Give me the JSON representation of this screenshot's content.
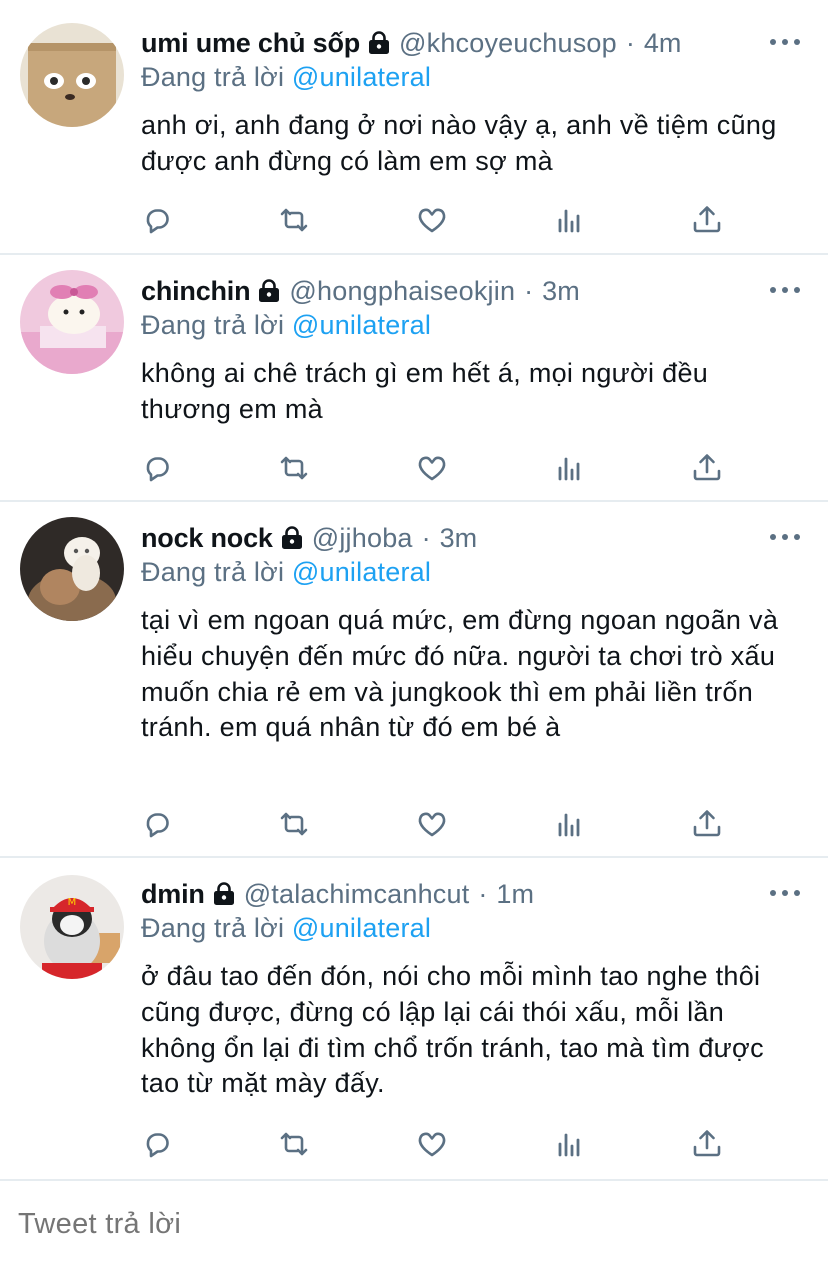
{
  "tweets": [
    {
      "name": "umi ume chủ sốp",
      "handle": "@khcoyeuchusop",
      "separator": "·",
      "time": "4m",
      "reply_prefix": "Đang trả lời",
      "reply_to": "@unilateral",
      "text": "anh ơi, anh đang ở nơi nào vậy ạ, anh về tiệm cũng được anh đừng có làm em sợ mà",
      "avatar": "paper-bag-cat-avatar"
    },
    {
      "name": "chinchin",
      "handle": "@hongphaiseokjin",
      "separator": "·",
      "time": "3m",
      "reply_prefix": "Đang trả lời",
      "reply_to": "@unilateral",
      "text": "không ai chê trách gì em hết á, mọi người đều thương em mà",
      "avatar": "hamster-pink-avatar"
    },
    {
      "name": "nock nock",
      "handle": "@jjhoba",
      "separator": "·",
      "time": "3m",
      "reply_prefix": "Đang trả lời",
      "reply_to": "@unilateral",
      "text": "tại vì em ngoan quá mức, em đừng ngoan ngoãn và hiểu chuyện đến mức đó nữa. người ta chơi trò xấu muốn chia rẻ em và jungkook thì em phải liền trốn tránh. em quá nhân từ đó em bé à",
      "avatar": "kittens-avatar"
    },
    {
      "name": "dmin",
      "handle": "@talachimcanhcut",
      "separator": "·",
      "time": "1m",
      "reply_prefix": "Đang trả lời",
      "reply_to": "@unilateral",
      "text": "ở đâu tao đến đón, nói cho mỗi mình tao nghe thôi cũng được, đừng có lập lại cái thói xấu, mỗi lần không ổn lại đi tìm chổ trốn tránh, tao mà tìm được tao từ mặt mày đấy.",
      "avatar": "penguin-cap-avatar"
    }
  ],
  "action_icons": [
    "reply-icon",
    "retweet-icon",
    "like-icon",
    "analytics-icon",
    "share-icon"
  ],
  "reply_box": {
    "placeholder": "Tweet trả lời"
  },
  "colors": {
    "text": "#0f1419",
    "secondary": "#5b7083",
    "accent": "#1da1f2",
    "separator": "#e6ecf0",
    "placeholder": "#8899a6"
  }
}
